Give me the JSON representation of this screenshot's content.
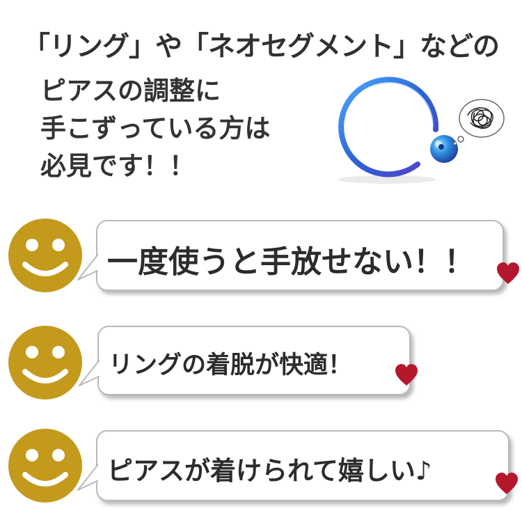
{
  "headline": "「リング」や「ネオセグメント」などの",
  "subtext": [
    "ピアスの調整に",
    "手こずっている方は",
    "必見です！！"
  ],
  "testimonials": [
    {
      "text": "一度使うと手放せない！！"
    },
    {
      "text": "リングの着脱が快適！"
    },
    {
      "text": "ピアスが着けられて嬉しい♪"
    }
  ],
  "colors": {
    "smiley_face": "#c39a1c",
    "smiley_features": "#ffffff",
    "heart": "#b5172d",
    "ring": "#2e6fd8",
    "bubble_border": "#b9b9b9",
    "text": "#2a2a2a"
  },
  "icons": [
    "smiley-icon",
    "heart-icon",
    "ring-product-image",
    "scribble-icon"
  ]
}
